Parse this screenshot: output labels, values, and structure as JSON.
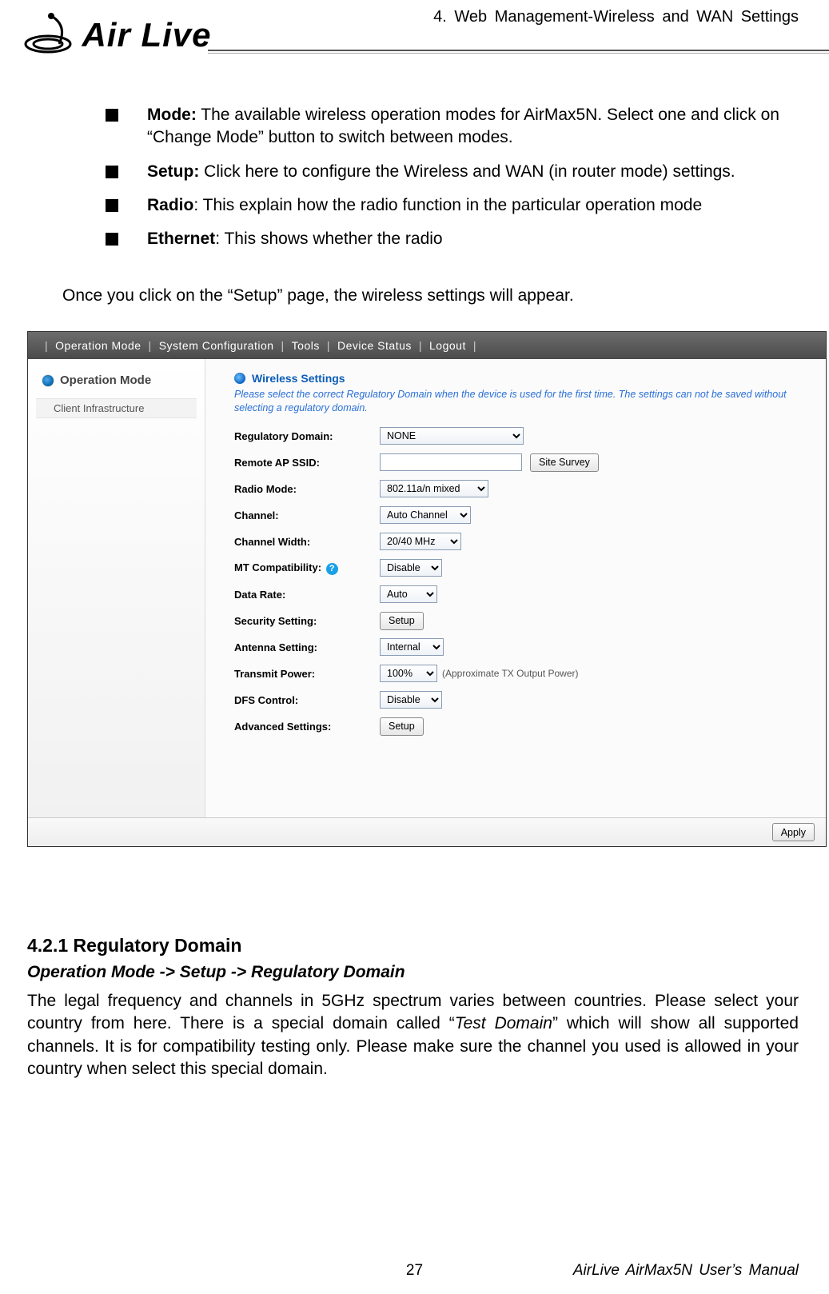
{
  "header": {
    "chapter": "4. Web Management-Wireless and WAN Settings",
    "logo_text": "Air Live"
  },
  "bullets": [
    {
      "strong": "Mode:",
      "rest": " The available wireless operation modes for AirMax5N. Select one and click on “Change Mode” button to switch between modes."
    },
    {
      "strong": "Setup:",
      "rest": " Click here to configure the Wireless and WAN (in router mode) settings."
    },
    {
      "strong": "Radio",
      "rest": ": This explain how the radio function in the particular operation mode"
    },
    {
      "strong": "Ethernet",
      "rest": ": This shows whether the radio"
    }
  ],
  "para_after": "Once you click on the “Setup” page, the wireless settings will appear.",
  "shot": {
    "menu": [
      "|",
      "Operation Mode",
      "|",
      "System Configuration",
      "|",
      "Tools",
      "|",
      "Device Status",
      "|",
      "Logout",
      "|"
    ],
    "sidebar": {
      "heading": "Operation Mode",
      "item": "Client Infrastructure"
    },
    "panel": {
      "title": "Wireless Settings",
      "note": "Please select the correct Regulatory Domain when the device is used for the first time. The settings can not be saved without selecting a regulatory domain.",
      "rows": {
        "reg_label": "Regulatory Domain:",
        "reg_value": "NONE",
        "ssid_label": "Remote AP SSID:",
        "ssid_value": "",
        "site_survey": "Site Survey",
        "radio_label": "Radio Mode:",
        "radio_value": "802.11a/n mixed",
        "channel_label": "Channel:",
        "channel_value": "Auto Channel",
        "chwidth_label": "Channel Width:",
        "chwidth_value": "20/40 MHz",
        "mt_label": "MT Compatibility:",
        "mt_value": "Disable",
        "rate_label": "Data Rate:",
        "rate_value": "Auto",
        "sec_label": "Security Setting:",
        "sec_btn": "Setup",
        "ant_label": "Antenna Setting:",
        "ant_value": "Internal",
        "tx_label": "Transmit Power:",
        "tx_value": "100%",
        "tx_note": "(Approximate TX Output Power)",
        "dfs_label": "DFS Control:",
        "dfs_value": "Disable",
        "adv_label": "Advanced Settings:",
        "adv_btn": "Setup"
      },
      "apply": "Apply"
    }
  },
  "section": {
    "heading": "4.2.1 Regulatory Domain",
    "sub": "Operation Mode -> Setup -> Regulatory Domain",
    "body_pre": "The legal frequency and channels in 5GHz spectrum varies between countries. Please select your country from here. There is a special domain called “",
    "body_em": "Test Domain",
    "body_post": "” which will show all supported channels. It is for compatibility testing only. Please make sure the channel you used is allowed in your country when select this special domain."
  },
  "footer": {
    "page": "27",
    "right": "AirLive AirMax5N User’s Manual"
  }
}
